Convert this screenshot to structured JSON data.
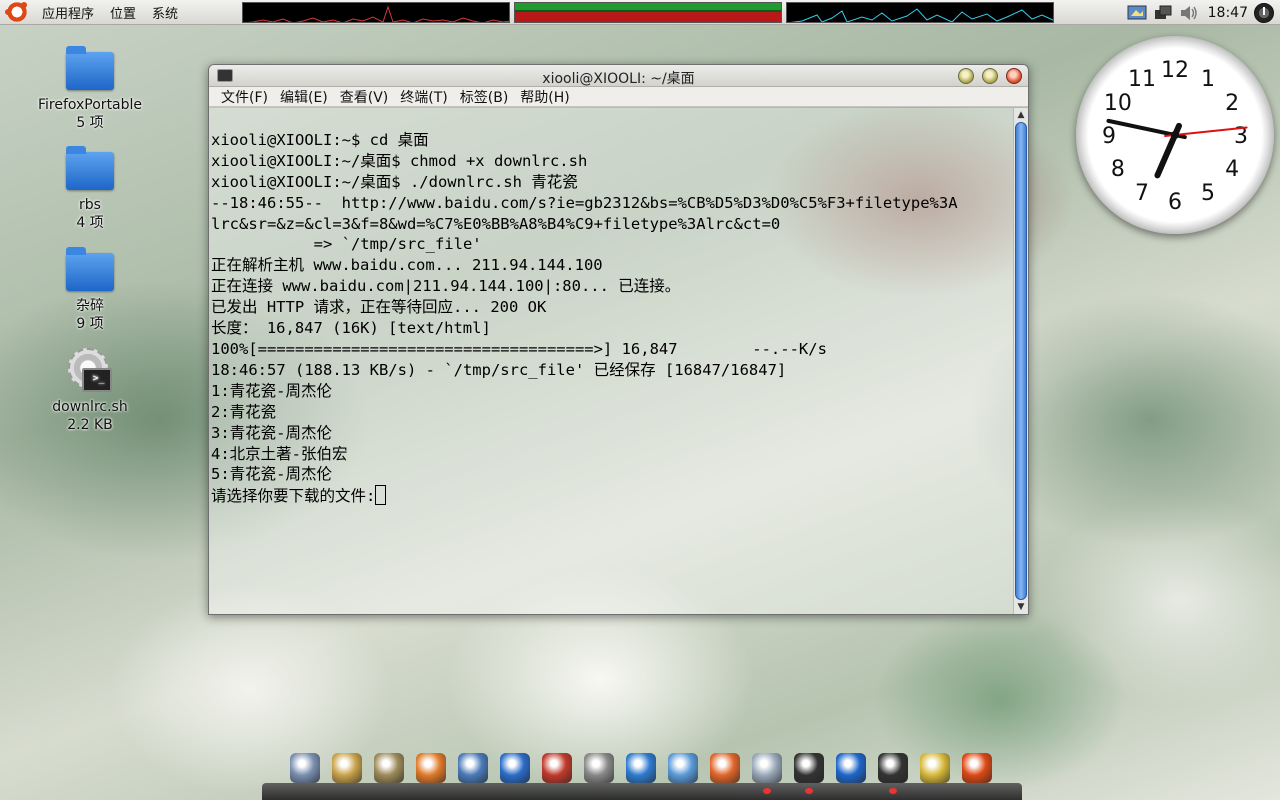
{
  "top_panel": {
    "menus": [
      "应用程序",
      "位置",
      "系统"
    ],
    "time": "18:47"
  },
  "desktop_icons": [
    {
      "name": "FirefoxPortable",
      "info": "5 项",
      "kind": "folder"
    },
    {
      "name": "rbs",
      "info": "4 项",
      "kind": "folder"
    },
    {
      "name": "杂碎",
      "info": "9 项",
      "kind": "folder"
    },
    {
      "name": "downlrc.sh",
      "info": "2.2 KB",
      "kind": "script"
    }
  ],
  "terminal": {
    "title": "xiooli@XIOOLI: ~/桌面",
    "menus": [
      "文件(F)",
      "编辑(E)",
      "查看(V)",
      "终端(T)",
      "标签(B)",
      "帮助(H)"
    ],
    "lines": [
      "xiooli@XIOOLI:~$ cd 桌面",
      "xiooli@XIOOLI:~/桌面$ chmod +x downlrc.sh",
      "xiooli@XIOOLI:~/桌面$ ./downlrc.sh 青花瓷",
      "--18:46:55--  http://www.baidu.com/s?ie=gb2312&bs=%CB%D5%D3%D0%C5%F3+filetype%3A",
      "lrc&sr=&z=&cl=3&f=8&wd=%C7%E0%BB%A8%B4%C9+filetype%3Alrc&ct=0",
      "           => `/tmp/src_file'",
      "正在解析主机 www.baidu.com... 211.94.144.100",
      "正在连接 www.baidu.com|211.94.144.100|:80... 已连接。",
      "已发出 HTTP 请求，正在等待回应... 200 OK",
      "长度： 16,847 (16K) [text/html]",
      "",
      "100%[====================================>] 16,847        --.--K/s",
      "",
      "18:46:57 (188.13 KB/s) - `/tmp/src_file' 已经保存 [16847/16847]",
      "",
      "1:青花瓷-周杰伦",
      "2:青花瓷",
      "3:青花瓷-周杰伦",
      "4:北京土著-张伯宏",
      "5:青花瓷-周杰伦"
    ],
    "prompt": "请选择你要下载的文件:"
  },
  "analog_clock": {
    "numbers": [
      "12",
      "1",
      "2",
      "3",
      "4",
      "5",
      "6",
      "7",
      "8",
      "9",
      "10",
      "11"
    ],
    "hour": 18,
    "minute": 47,
    "second": 14
  },
  "dock": {
    "colors": [
      "#7a8fb0",
      "#c9a24a",
      "#9c8a5a",
      "#e07a2a",
      "#4a7ab8",
      "#2b6cc8",
      "#c0392b",
      "#888888",
      "#2e7bcf",
      "#5a9ad8",
      "#e0662a",
      "#9aa8b8",
      "#333333",
      "#1e66c9",
      "#333333",
      "#d6b83a",
      "#dd4814"
    ],
    "active": [
      11,
      12,
      14
    ]
  },
  "colors": {
    "accent": "#dd4814",
    "folder": "#2e7bd8",
    "scroll_thumb": "#3e7fd8"
  }
}
